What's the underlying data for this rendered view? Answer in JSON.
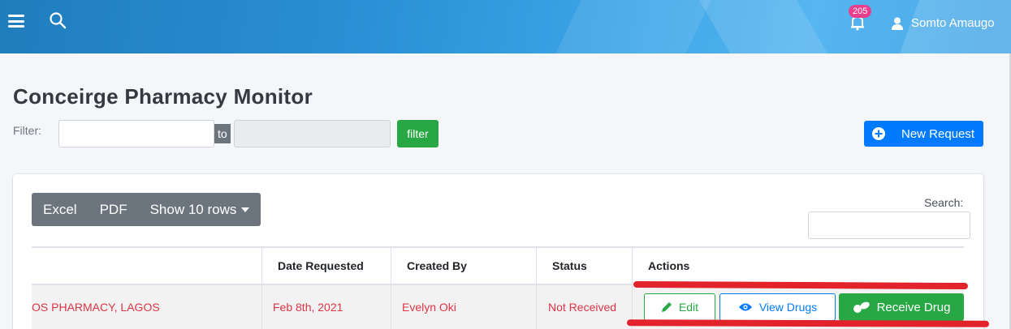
{
  "topbar": {
    "notification_count": "205",
    "user_name": "Somto Amaugo"
  },
  "page": {
    "title": "Conceirge Pharmacy Monitor"
  },
  "filter": {
    "label": "Filter:",
    "from_value": "",
    "to_label": "to",
    "to_value": "",
    "button_label": "filter"
  },
  "actions": {
    "new_request_label": "New Request"
  },
  "table_tools": {
    "excel_label": "Excel",
    "pdf_label": "PDF",
    "show_rows_label": "Show 10 rows",
    "search_label": "Search:",
    "search_value": ""
  },
  "table": {
    "columns": [
      "",
      "Date Requested",
      "Created By",
      "Status",
      "Actions"
    ],
    "rows": [
      {
        "pharmacy": "OS PHARMACY, LAGOS",
        "date_requested": "Feb 8th, 2021",
        "created_by": "Evelyn Oki",
        "status": "Not Received",
        "edit_label": "Edit",
        "view_label": "View Drugs",
        "receive_label": "Receive Drug"
      }
    ]
  },
  "colors": {
    "primary": "#007bff",
    "success": "#28a745",
    "danger_text": "#dc3545",
    "secondary": "#6c757d",
    "badge": "#e83e8c",
    "annotation_red": "#e3232b"
  }
}
